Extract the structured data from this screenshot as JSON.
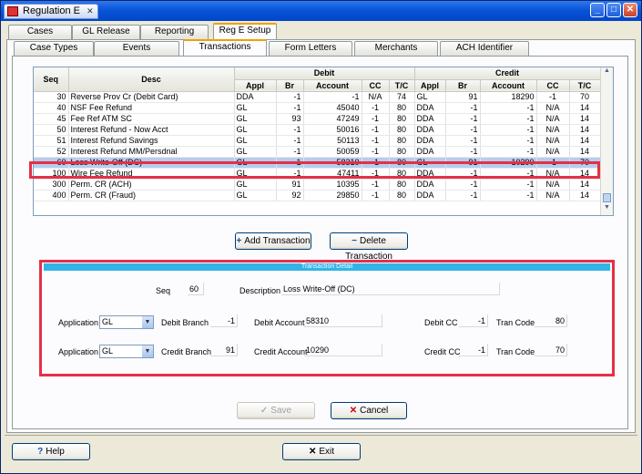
{
  "window": {
    "title": "Regulation E",
    "close_glyph": "✕",
    "min": "_",
    "max": "□",
    "close": "✕"
  },
  "tabs_top": [
    "Cases",
    "GL Release",
    "Reporting",
    "Reg E Setup"
  ],
  "tabs_sub": [
    "Case Types",
    "Events",
    "Transactions",
    "Form Letters",
    "Merchants",
    "ACH Identifier"
  ],
  "grid": {
    "group_headers": {
      "seq": "Seq",
      "desc": "Desc",
      "debit": "Debit",
      "credit": "Credit"
    },
    "columns": [
      "Appl",
      "Br",
      "Account",
      "CC",
      "T/C",
      "Appl",
      "Br",
      "Account",
      "CC",
      "T/C"
    ],
    "rows": [
      {
        "seq": "30",
        "desc": "Reverse Prov Cr (Debit Card)",
        "d_appl": "DDA",
        "d_br": "-1",
        "d_acct": "-1",
        "d_cc": "N/A",
        "d_tc": "74",
        "c_appl": "GL",
        "c_br": "91",
        "c_acct": "18290",
        "c_cc": "-1",
        "c_tc": "70"
      },
      {
        "seq": "40",
        "desc": "NSF Fee Refund",
        "d_appl": "GL",
        "d_br": "-1",
        "d_acct": "45040",
        "d_cc": "-1",
        "d_tc": "80",
        "c_appl": "DDA",
        "c_br": "-1",
        "c_acct": "-1",
        "c_cc": "N/A",
        "c_tc": "14"
      },
      {
        "seq": "45",
        "desc": "Fee Ref ATM SC",
        "d_appl": "GL",
        "d_br": "93",
        "d_acct": "47249",
        "d_cc": "-1",
        "d_tc": "80",
        "c_appl": "DDA",
        "c_br": "-1",
        "c_acct": "-1",
        "c_cc": "N/A",
        "c_tc": "14"
      },
      {
        "seq": "50",
        "desc": "Interest Refund - Now Acct",
        "d_appl": "GL",
        "d_br": "-1",
        "d_acct": "50016",
        "d_cc": "-1",
        "d_tc": "80",
        "c_appl": "DDA",
        "c_br": "-1",
        "c_acct": "-1",
        "c_cc": "N/A",
        "c_tc": "14"
      },
      {
        "seq": "51",
        "desc": "Interest Refund Savings",
        "d_appl": "GL",
        "d_br": "-1",
        "d_acct": "50113",
        "d_cc": "-1",
        "d_tc": "80",
        "c_appl": "DDA",
        "c_br": "-1",
        "c_acct": "-1",
        "c_cc": "N/A",
        "c_tc": "14"
      },
      {
        "seq": "52",
        "desc": "Interest Refund MM/Persdnal",
        "d_appl": "GL",
        "d_br": "-1",
        "d_acct": "50059",
        "d_cc": "-1",
        "d_tc": "80",
        "c_appl": "DDA",
        "c_br": "-1",
        "c_acct": "-1",
        "c_cc": "N/A",
        "c_tc": "14"
      },
      {
        "seq": "60",
        "desc": "Loss Write-Off (DC)",
        "d_appl": "GL",
        "d_br": "-1",
        "d_acct": "58310",
        "d_cc": "-1",
        "d_tc": "80",
        "c_appl": "GL",
        "c_br": "91",
        "c_acct": "10290",
        "c_cc": "-1",
        "c_tc": "70"
      },
      {
        "seq": "100",
        "desc": "Wire Fee Refund",
        "d_appl": "GL",
        "d_br": "-1",
        "d_acct": "47411",
        "d_cc": "-1",
        "d_tc": "80",
        "c_appl": "DDA",
        "c_br": "-1",
        "c_acct": "-1",
        "c_cc": "N/A",
        "c_tc": "14"
      },
      {
        "seq": "300",
        "desc": "Perm. CR (ACH)",
        "d_appl": "GL",
        "d_br": "91",
        "d_acct": "10395",
        "d_cc": "-1",
        "d_tc": "80",
        "c_appl": "DDA",
        "c_br": "-1",
        "c_acct": "-1",
        "c_cc": "N/A",
        "c_tc": "14"
      },
      {
        "seq": "400",
        "desc": "Perm. CR (Fraud)",
        "d_appl": "GL",
        "d_br": "92",
        "d_acct": "29850",
        "d_cc": "-1",
        "d_tc": "80",
        "c_appl": "DDA",
        "c_br": "-1",
        "c_acct": "-1",
        "c_cc": "N/A",
        "c_tc": "14"
      }
    ],
    "selected_row": 6
  },
  "buttons": {
    "add": "Add Transaction",
    "delete": "Delete Transaction",
    "save": "Save",
    "cancel": "Cancel",
    "help": "Help",
    "exit": "Exit"
  },
  "detail": {
    "header": "Transaction Detail",
    "seq_label": "Seq",
    "seq": "60",
    "desc_label": "Description",
    "desc": "Loss Write-Off (DC)",
    "app_label": "Application",
    "debit_app": "GL",
    "debit_branch_label": "Debit Branch",
    "debit_branch": "-1",
    "debit_account_label": "Debit Account",
    "debit_account": "58310",
    "debit_cc_label": "Debit CC",
    "debit_cc": "-1",
    "tran_code_label": "Tran Code",
    "debit_tran_code": "80",
    "credit_app": "GL",
    "credit_branch_label": "Credit Branch",
    "credit_branch": "91",
    "credit_account_label": "Credit Account",
    "credit_account": "10290",
    "credit_cc_label": "Credit CC",
    "credit_cc": "-1",
    "credit_tran_code": "70"
  },
  "colors": {
    "title_bar": "#0a54d8",
    "highlight": "#e53047",
    "selected_row": "#b6cdef",
    "detail_header": "#33b4e8"
  }
}
